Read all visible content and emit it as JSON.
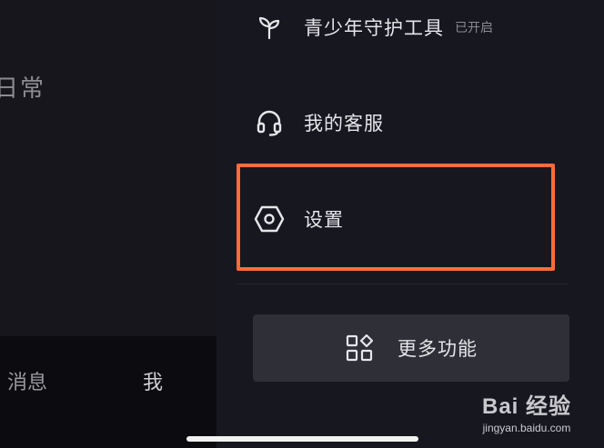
{
  "background_page": {
    "title_fragment": "日常",
    "bottom_tabs": [
      "消息",
      "我"
    ]
  },
  "drawer": {
    "items": [
      {
        "label": "青少年守护工具",
        "badge": "已开启",
        "icon": "sprout-icon"
      },
      {
        "label": "我的客服",
        "icon": "headset-icon"
      },
      {
        "label": "设置",
        "icon": "hexagon-settings-icon"
      }
    ],
    "more_button": {
      "label": "更多功能",
      "icon": "grid-apps-icon"
    },
    "highlight_color": "#ff6b3d"
  },
  "watermark": {
    "brand": "Bai  经验",
    "site": "jingyan.baidu.com"
  }
}
